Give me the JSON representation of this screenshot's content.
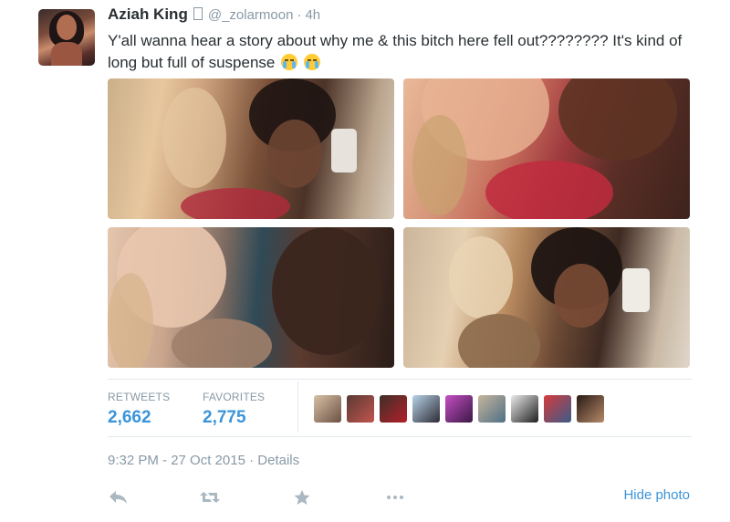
{
  "tweet": {
    "author_name": "Aziah King",
    "verified_glyph": "",
    "handle": "@_zolarmoon",
    "separator": "·",
    "time_ago": "4h",
    "text": "Y'all wanna hear a story about why me & this bitch here fell out???????? It's kind of long but full of suspense",
    "emojis": [
      "face-with-tears-of-joy",
      "loudly-crying-face"
    ]
  },
  "stats": {
    "retweets_label": "RETWEETS",
    "retweets_count": "2,662",
    "favorites_label": "FAVORITES",
    "favorites_count": "2,775",
    "favoriter_avatar_count": 9
  },
  "timestamp": {
    "time": "9:32 PM - 27 Oct 2015",
    "separator": "·",
    "details_label": "Details"
  },
  "actions": {
    "icons": [
      "reply-icon",
      "retweet-icon",
      "favorite-star-icon",
      "more-icon"
    ],
    "hide_photo_label": "Hide photo"
  },
  "colors": {
    "link_blue": "#3b94d9",
    "muted_gray": "#8899a6",
    "text_dark": "#292f33",
    "divider": "#e1e8ed"
  }
}
